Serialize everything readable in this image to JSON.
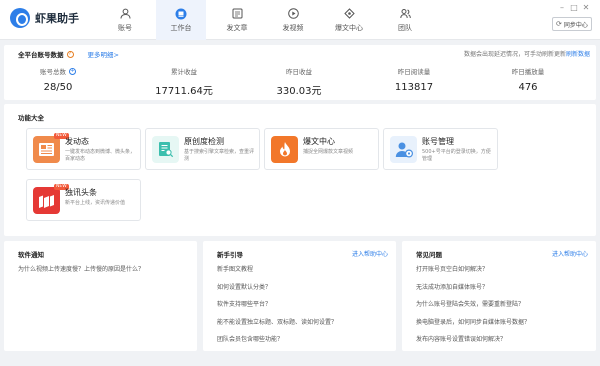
{
  "app": {
    "name": "虾果助手"
  },
  "nav": [
    {
      "label": "账号",
      "icon": "user-icon"
    },
    {
      "label": "工作台",
      "icon": "workbench-icon",
      "active": true
    },
    {
      "label": "发文章",
      "icon": "article-icon"
    },
    {
      "label": "发视频",
      "icon": "video-icon"
    },
    {
      "label": "爆文中心",
      "icon": "hot-article-icon"
    },
    {
      "label": "团队",
      "icon": "team-icon"
    }
  ],
  "window": {
    "sync_label": "同步中心"
  },
  "stats": {
    "title": "全平台账号数据",
    "more_link": "更多明细>",
    "note": "数据会出现延迟情况，可手动刷新更新",
    "refresh": "刷新数据",
    "items": [
      {
        "label": "账号总数",
        "value": "28/50"
      },
      {
        "label": "累计收益",
        "value": "17711.64元"
      },
      {
        "label": "昨日收益",
        "value": "330.03元"
      },
      {
        "label": "昨日阅读量",
        "value": "113817"
      },
      {
        "label": "昨日播放量",
        "value": "476"
      }
    ]
  },
  "functions": {
    "title": "功能大全",
    "cards": [
      {
        "title": "发动态",
        "desc": "一键发布动态到微博、微头条，百家动态",
        "badge": "NEW",
        "icon": "news-icon",
        "color": "#f08a4b"
      },
      {
        "title": "原创度检测",
        "desc": "基于搜索引擎文章检索，查重评测",
        "badge": "",
        "icon": "document-check-icon",
        "color": "#3cbfae"
      },
      {
        "title": "爆文中心",
        "desc": "捕捉全网爆款文章视频",
        "badge": "",
        "icon": "flame-icon",
        "color": "#f2772a"
      },
      {
        "title": "账号管理",
        "desc": "500+号平台的登录切换，方便管理",
        "badge": "",
        "icon": "account-gear-icon",
        "color": "#4a90e2"
      },
      {
        "title": "独讯头条",
        "desc": "新平台上线，资讯传递价值",
        "badge": "NEW",
        "icon": "headline-icon",
        "color": "#e53935"
      }
    ]
  },
  "notice": {
    "title": "软件通知",
    "items": [
      "为什么视频上传速度慢？上传慢的原因是什么？"
    ]
  },
  "guide": {
    "title": "新手引导",
    "link": "进入帮助中心",
    "items": [
      "新手图文教程",
      "如何设置默认分类？",
      "软件支持哪些平台？",
      "能不能设置独立标题、双标题、读如何设置？",
      "团队会员包含哪些功能？"
    ]
  },
  "faq": {
    "title": "常见问题",
    "link": "进入帮助中心",
    "items": [
      "打开账号页空白如何解决？",
      "无法成功添加自媒体账号？",
      "为什么账号登陆会失效，需要重新登陆？",
      "换电脑登录后，如何同步自媒体账号数据？",
      "发布内容账号设置错误如何解决？"
    ]
  }
}
